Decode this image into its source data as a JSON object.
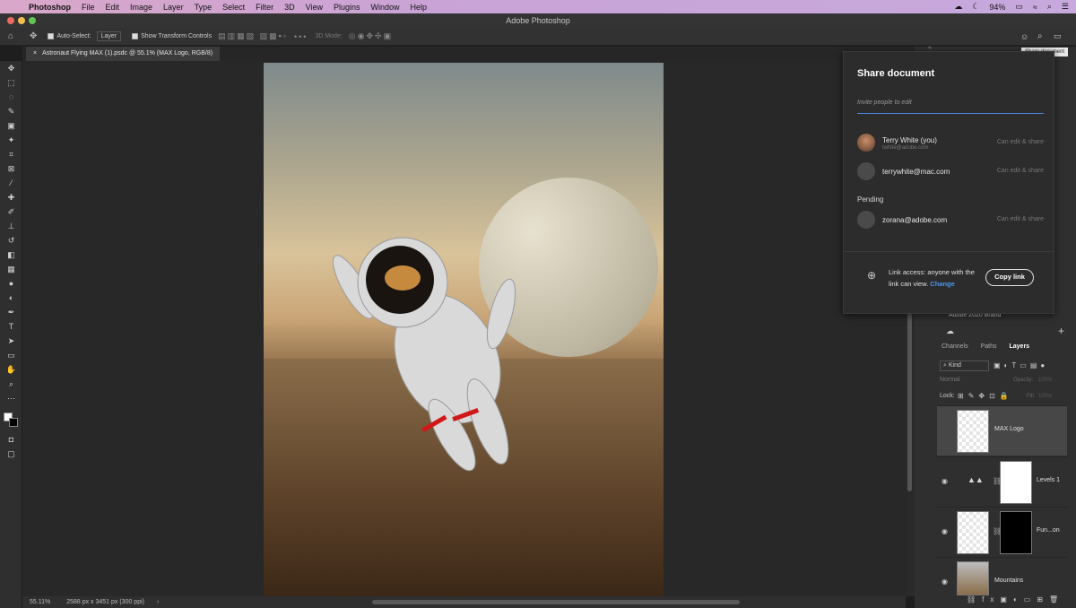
{
  "menubar": {
    "app": "Photoshop",
    "items": [
      "File",
      "Edit",
      "Image",
      "Layer",
      "Type",
      "Select",
      "Filter",
      "3D",
      "View",
      "Plugins",
      "Window",
      "Help"
    ],
    "battery": "94%"
  },
  "window": {
    "title": "Adobe Photoshop"
  },
  "options": {
    "auto_select": "Auto-Select:",
    "layer_select": "Layer",
    "transform": "Show Transform Controls",
    "mode3d": "3D Mode:"
  },
  "document": {
    "tab": "Astronaut Flying MAX (1).psdc @ 55.1% (MAX Logo, RGB/8)"
  },
  "status": {
    "zoom": "55.11%",
    "size": "2588 px x 3451 px (300 ppi)"
  },
  "tooltip": "Share document",
  "share": {
    "title": "Share document",
    "invite_placeholder": "Invite people to edit",
    "people": [
      {
        "name": "Terry White (you)",
        "email": "twhite@adobe.com",
        "perm": "Can edit & share"
      },
      {
        "name": "terrywhite@mac.com",
        "email": "",
        "perm": "Can edit & share"
      }
    ],
    "pending_label": "Pending",
    "pending": [
      {
        "name": "zorana@adobe.com",
        "perm": "Can edit & share"
      }
    ],
    "link_text": "Link access: anyone with the link can view.",
    "change": "Change",
    "copy": "Copy link"
  },
  "libraries": {
    "brand": "Adobe 2020 Brand"
  },
  "layers_panel": {
    "tabs": [
      "Channels",
      "Paths",
      "Layers"
    ],
    "kind": "Kind",
    "blend": "Normal",
    "opacity_label": "Opacity:",
    "opacity": "100%",
    "lock_label": "Lock:",
    "fill_label": "Fill:",
    "fill": "100%",
    "layers": [
      {
        "name": "MAX Logo"
      },
      {
        "name": "Levels 1"
      },
      {
        "name": "Fun...on"
      },
      {
        "name": "Mountains"
      }
    ]
  }
}
